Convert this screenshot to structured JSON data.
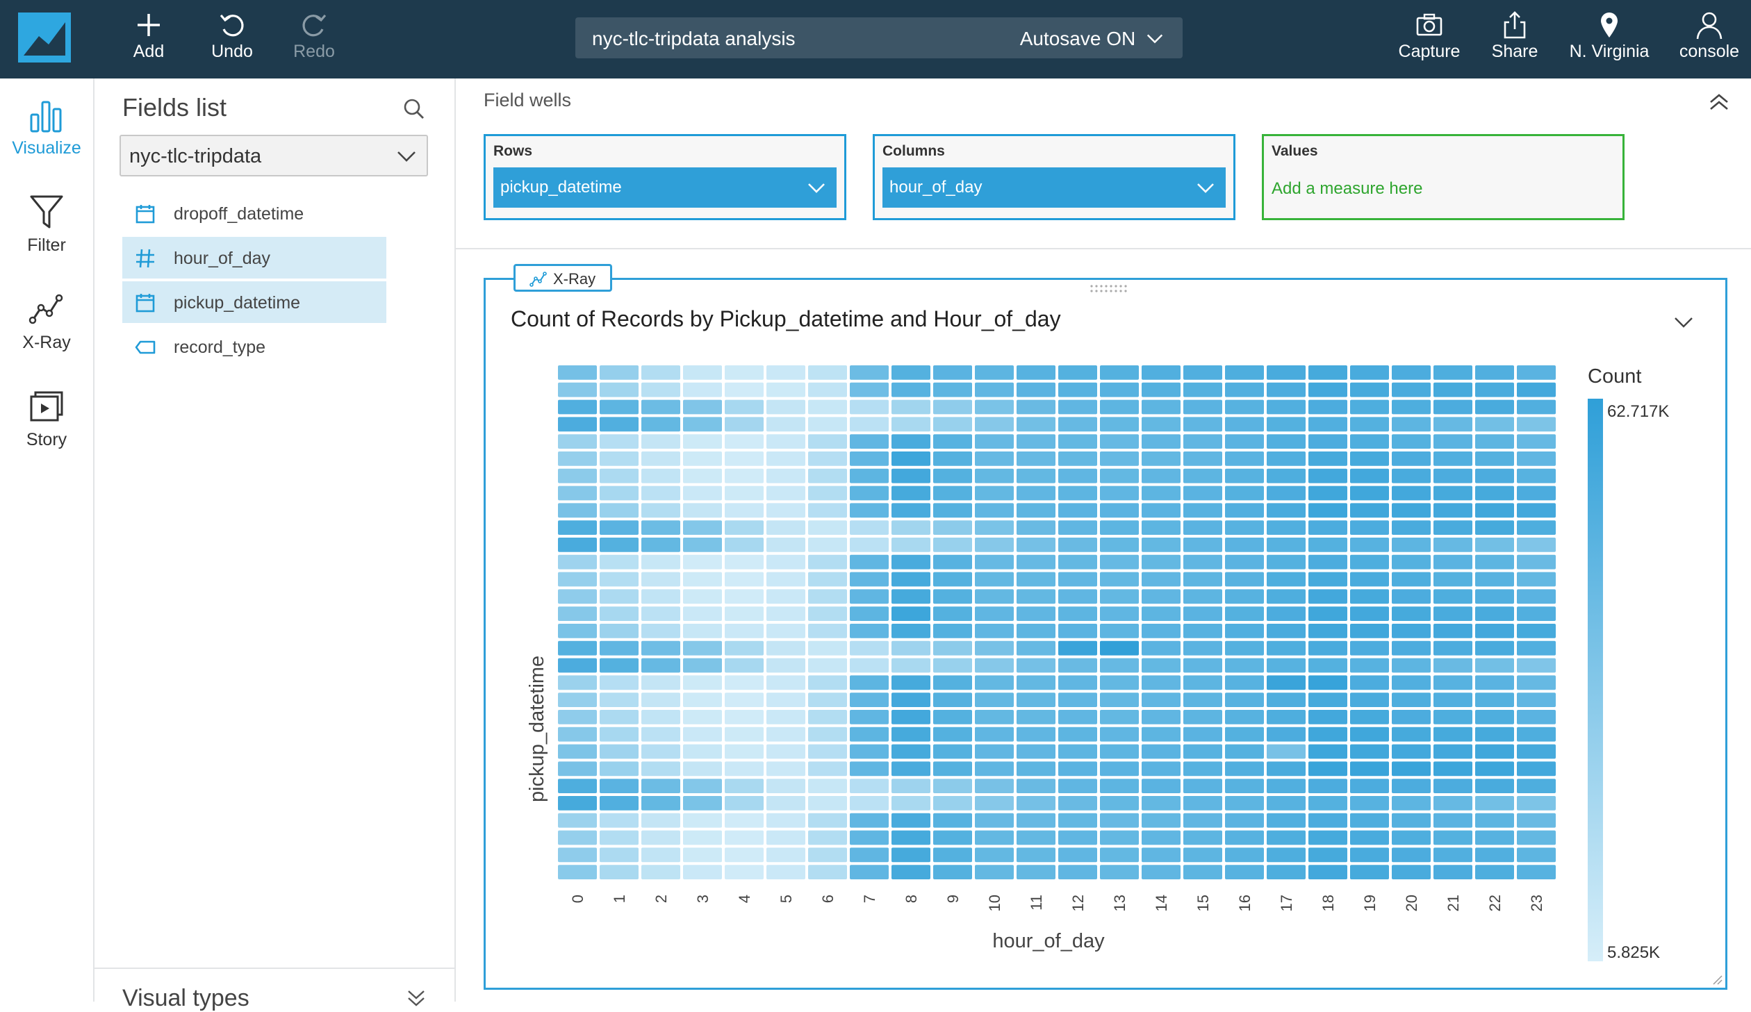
{
  "topbar": {
    "add_label": "Add",
    "undo_label": "Undo",
    "redo_label": "Redo",
    "analysis_name": "nyc-tlc-tripdata analysis",
    "autosave_label": "Autosave ON",
    "capture_label": "Capture",
    "share_label": "Share",
    "region_label": "N. Virginia",
    "user_label": "console"
  },
  "leftnav": {
    "items": [
      {
        "label": "Visualize",
        "icon": "bar-chart-icon",
        "active": true
      },
      {
        "label": "Filter",
        "icon": "funnel-icon",
        "active": false
      },
      {
        "label": "X-Ray",
        "icon": "xray-line-icon",
        "active": false
      },
      {
        "label": "Story",
        "icon": "story-icon",
        "active": false
      }
    ]
  },
  "fields_panel": {
    "title": "Fields list",
    "dataset": "nyc-tlc-tripdata",
    "fields": [
      {
        "label": "dropoff_datetime",
        "icon": "calendar-icon",
        "selected": false
      },
      {
        "label": "hour_of_day",
        "icon": "hash-icon",
        "selected": true
      },
      {
        "label": "pickup_datetime",
        "icon": "calendar-icon",
        "selected": true
      },
      {
        "label": "record_type",
        "icon": "tag-icon",
        "selected": false
      }
    ],
    "visual_types_label": "Visual types"
  },
  "field_wells": {
    "title": "Field wells",
    "rows": {
      "label": "Rows",
      "value": "pickup_datetime"
    },
    "columns": {
      "label": "Columns",
      "value": "hour_of_day"
    },
    "values": {
      "label": "Values",
      "placeholder": "Add a measure here"
    }
  },
  "visual": {
    "xray_label": "X-Ray"
  },
  "colors": {
    "accent": "#1f9bd7",
    "topbar": "#1e3a4d",
    "values_well": "#38b33a",
    "heat_low": "#d6eef9",
    "heat_high": "#2f9fd8"
  },
  "chart_data": {
    "type": "heatmap",
    "title": "Count of Records by Pickup_datetime and Hour_of_day",
    "xlabel": "hour_of_day",
    "ylabel": "pickup_datetime",
    "x": [
      "0",
      "1",
      "2",
      "3",
      "4",
      "5",
      "6",
      "7",
      "8",
      "9",
      "10",
      "11",
      "12",
      "13",
      "14",
      "15",
      "16",
      "17",
      "18",
      "19",
      "20",
      "21",
      "22",
      "23"
    ],
    "row_count": 30,
    "legend_title": "Count",
    "legend_max": "62.717K",
    "legend_min": "5.825K",
    "legend_max_value": 62717,
    "legend_min_value": 5825,
    "values": [
      [
        39000,
        28000,
        18000,
        11000,
        9000,
        10000,
        14000,
        42000,
        50000,
        48000,
        47000,
        49000,
        50000,
        50000,
        51000,
        51000,
        52000,
        54000,
        55000,
        54000,
        53000,
        52000,
        51000,
        48000
      ],
      [
        33000,
        24000,
        16000,
        10000,
        8000,
        9000,
        13000,
        41000,
        49000,
        47000,
        46000,
        48000,
        49000,
        49000,
        50000,
        50000,
        51000,
        53000,
        56000,
        55000,
        54000,
        55000,
        54000,
        56000
      ],
      [
        51000,
        47000,
        42000,
        35000,
        22000,
        12000,
        11000,
        17000,
        24000,
        30000,
        37000,
        43000,
        46000,
        47000,
        47000,
        48000,
        49000,
        51000,
        53000,
        52000,
        52000,
        53000,
        54000,
        51000
      ],
      [
        53000,
        51000,
        45000,
        37000,
        23000,
        12000,
        11000,
        15000,
        21000,
        27000,
        33000,
        40000,
        44000,
        45000,
        45000,
        46000,
        48000,
        50000,
        51000,
        50000,
        47000,
        44000,
        40000,
        36000
      ],
      [
        26000,
        17000,
        12000,
        9000,
        8000,
        10000,
        18000,
        46000,
        54000,
        49000,
        44000,
        44000,
        45000,
        44000,
        46000,
        46000,
        48000,
        51000,
        53000,
        52000,
        50000,
        48000,
        47000,
        44000
      ],
      [
        28000,
        18000,
        12000,
        9000,
        8000,
        10000,
        17000,
        46000,
        58000,
        50000,
        44000,
        44000,
        45000,
        44000,
        45000,
        46000,
        48000,
        51000,
        55000,
        55000,
        53000,
        51000,
        50000,
        46000
      ],
      [
        31000,
        20000,
        13000,
        9000,
        8000,
        10000,
        18000,
        47000,
        56000,
        50000,
        45000,
        45000,
        46000,
        45000,
        46000,
        47000,
        49000,
        52000,
        56000,
        56000,
        54000,
        53000,
        53000,
        49000
      ],
      [
        33000,
        22000,
        15000,
        10000,
        9000,
        10000,
        18000,
        47000,
        55000,
        50000,
        45000,
        46000,
        47000,
        46000,
        47000,
        48000,
        50000,
        53000,
        57000,
        57000,
        56000,
        55000,
        55000,
        53000
      ],
      [
        38000,
        27000,
        18000,
        12000,
        10000,
        10000,
        17000,
        46000,
        54000,
        50000,
        46000,
        47000,
        48000,
        48000,
        48000,
        49000,
        51000,
        54000,
        58000,
        57000,
        57000,
        56000,
        57000,
        56000
      ],
      [
        52000,
        48000,
        42000,
        34000,
        21000,
        12000,
        11000,
        17000,
        24000,
        31000,
        37000,
        43000,
        46000,
        47000,
        47000,
        48000,
        49000,
        51000,
        53000,
        53000,
        54000,
        54000,
        55000,
        52000
      ],
      [
        54000,
        50000,
        45000,
        37000,
        22000,
        12000,
        11000,
        15000,
        21000,
        27000,
        33000,
        39000,
        43000,
        45000,
        45000,
        46000,
        48000,
        49000,
        50000,
        49000,
        47000,
        44000,
        40000,
        35000
      ],
      [
        25000,
        16000,
        11000,
        8000,
        8000,
        10000,
        18000,
        46000,
        54000,
        49000,
        44000,
        44000,
        45000,
        44000,
        45000,
        46000,
        48000,
        50000,
        53000,
        52000,
        50000,
        48000,
        47000,
        43000
      ],
      [
        28000,
        18000,
        12000,
        9000,
        8000,
        10000,
        18000,
        46000,
        55000,
        50000,
        45000,
        45000,
        46000,
        45000,
        46000,
        47000,
        49000,
        52000,
        55000,
        54000,
        52000,
        50000,
        49000,
        45000
      ],
      [
        30000,
        20000,
        13000,
        9000,
        8000,
        10000,
        18000,
        46000,
        55000,
        50000,
        45000,
        45000,
        46000,
        45000,
        46000,
        47000,
        49000,
        52000,
        56000,
        55000,
        53000,
        52000,
        51000,
        48000
      ],
      [
        33000,
        22000,
        15000,
        10000,
        9000,
        10000,
        18000,
        47000,
        58000,
        50000,
        46000,
        46000,
        47000,
        46000,
        47000,
        48000,
        50000,
        53000,
        57000,
        56000,
        55000,
        54000,
        54000,
        51000
      ],
      [
        37000,
        26000,
        17000,
        11000,
        10000,
        10000,
        17000,
        46000,
        55000,
        50000,
        46000,
        47000,
        48000,
        47000,
        48000,
        49000,
        51000,
        54000,
        57000,
        57000,
        56000,
        56000,
        56000,
        55000
      ],
      [
        50000,
        46000,
        41000,
        33000,
        21000,
        12000,
        11000,
        17000,
        25000,
        31000,
        38000,
        44000,
        59000,
        62000,
        48000,
        48000,
        50000,
        52000,
        54000,
        53000,
        53000,
        53000,
        54000,
        51000
      ],
      [
        53000,
        50000,
        44000,
        36000,
        22000,
        12000,
        11000,
        15000,
        21000,
        27000,
        33000,
        39000,
        43000,
        44000,
        45000,
        46000,
        47000,
        49000,
        50000,
        49000,
        47000,
        43000,
        40000,
        35000
      ],
      [
        26000,
        17000,
        12000,
        9000,
        8000,
        10000,
        18000,
        47000,
        55000,
        50000,
        45000,
        45000,
        46000,
        45000,
        46000,
        47000,
        49000,
        59000,
        60000,
        53000,
        51000,
        49000,
        48000,
        44000
      ],
      [
        28000,
        18000,
        12000,
        9000,
        8000,
        10000,
        18000,
        46000,
        56000,
        50000,
        45000,
        45000,
        46000,
        45000,
        46000,
        47000,
        49000,
        52000,
        55000,
        54000,
        52000,
        51000,
        50000,
        46000
      ],
      [
        30000,
        20000,
        13000,
        9000,
        8000,
        10000,
        18000,
        46000,
        56000,
        50000,
        45000,
        45000,
        46000,
        45000,
        46000,
        47000,
        49000,
        52000,
        56000,
        55000,
        53000,
        52000,
        52000,
        48000
      ],
      [
        33000,
        22000,
        15000,
        10000,
        9000,
        10000,
        18000,
        47000,
        55000,
        50000,
        46000,
        46000,
        47000,
        46000,
        47000,
        48000,
        50000,
        53000,
        57000,
        57000,
        55000,
        55000,
        55000,
        52000
      ],
      [
        36000,
        25000,
        17000,
        11000,
        9000,
        10000,
        17000,
        46000,
        55000,
        50000,
        46000,
        46000,
        47000,
        47000,
        48000,
        49000,
        50000,
        38000,
        58000,
        57000,
        56000,
        56000,
        57000,
        55000
      ],
      [
        38000,
        27000,
        18000,
        12000,
        10000,
        10000,
        17000,
        46000,
        54000,
        50000,
        46000,
        47000,
        48000,
        48000,
        48000,
        49000,
        51000,
        54000,
        59000,
        59000,
        59000,
        58000,
        58000,
        56000
      ],
      [
        52000,
        48000,
        42000,
        34000,
        21000,
        12000,
        11000,
        17000,
        25000,
        31000,
        38000,
        43000,
        46000,
        47000,
        48000,
        48000,
        49000,
        51000,
        53000,
        53000,
        53000,
        53000,
        54000,
        52000
      ],
      [
        55000,
        51000,
        45000,
        37000,
        22000,
        12000,
        11000,
        15000,
        21000,
        27000,
        33000,
        39000,
        43000,
        45000,
        45000,
        46000,
        47000,
        49000,
        50000,
        49000,
        47000,
        44000,
        40000,
        36000
      ],
      [
        26000,
        17000,
        12000,
        9000,
        8000,
        10000,
        18000,
        46000,
        54000,
        49000,
        44000,
        44000,
        45000,
        44000,
        45000,
        46000,
        48000,
        51000,
        53000,
        52000,
        50000,
        48000,
        47000,
        43000
      ],
      [
        28000,
        18000,
        12000,
        9000,
        8000,
        10000,
        18000,
        46000,
        55000,
        50000,
        45000,
        45000,
        46000,
        45000,
        46000,
        47000,
        49000,
        52000,
        55000,
        54000,
        52000,
        50000,
        49000,
        45000
      ],
      [
        30000,
        20000,
        13000,
        9000,
        8000,
        10000,
        18000,
        46000,
        55000,
        50000,
        45000,
        45000,
        46000,
        45000,
        46000,
        47000,
        49000,
        52000,
        55000,
        54000,
        53000,
        51000,
        51000,
        47000
      ],
      [
        32000,
        21000,
        14000,
        10000,
        8000,
        10000,
        18000,
        46000,
        55000,
        50000,
        45000,
        45000,
        46000,
        45000,
        46000,
        47000,
        49000,
        52000,
        56000,
        55000,
        54000,
        53000,
        52000,
        49000
      ]
    ]
  }
}
